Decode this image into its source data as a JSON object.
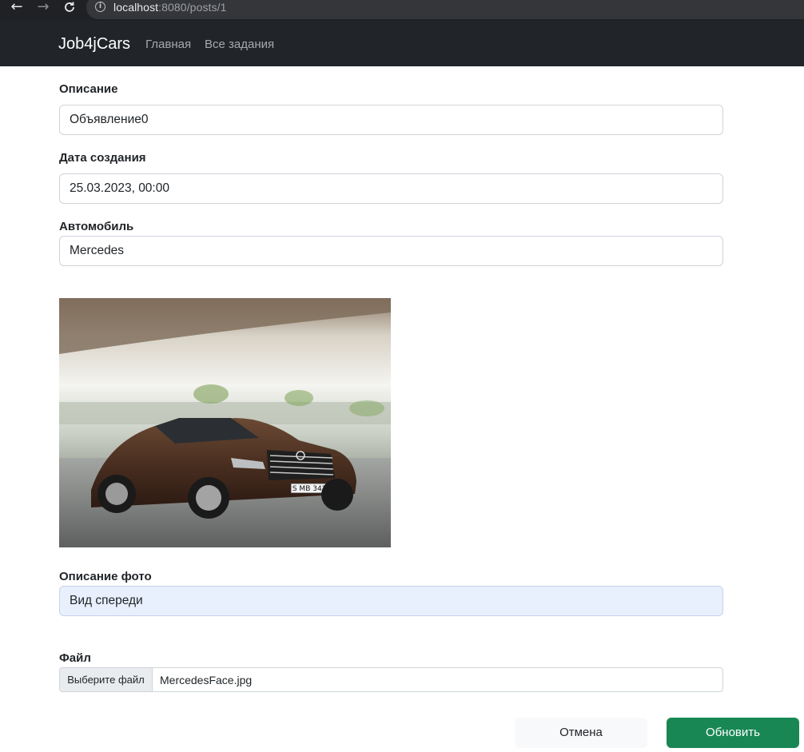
{
  "browser": {
    "url_host": "localhost",
    "url_rest": ":8080/posts/1"
  },
  "navbar": {
    "brand": "Job4jCars",
    "links": [
      {
        "label": "Главная"
      },
      {
        "label": "Все задания"
      }
    ]
  },
  "form": {
    "description": {
      "label": "Описание",
      "value": "Объявление0"
    },
    "created": {
      "label": "Дата создания",
      "value": "25.03.2023, 00:00"
    },
    "car": {
      "label": "Автомобиль",
      "value": "Mercedes"
    },
    "photo": {
      "plate": "S MB 3420"
    },
    "photo_description": {
      "label": "Описание фото",
      "value": "Вид спереди"
    },
    "file": {
      "label": "Файл",
      "button": "Выберите файл",
      "filename": "MercedesFace.jpg"
    }
  },
  "buttons": {
    "cancel": "Отмена",
    "update": "Обновить"
  },
  "colors": {
    "navbar_bg": "#212529",
    "primary_action": "#198754",
    "focused_input": "#e8f0fe"
  }
}
